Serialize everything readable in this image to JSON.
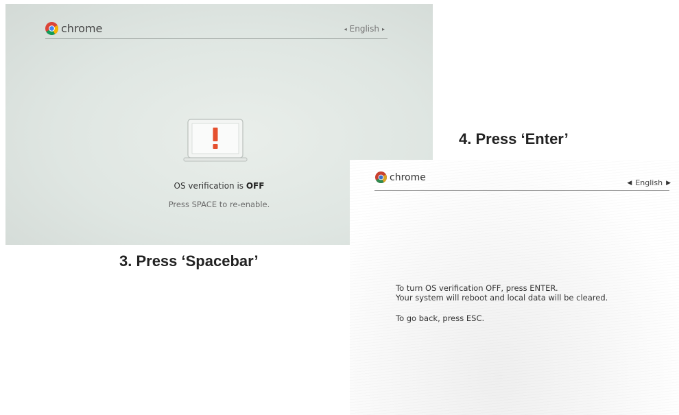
{
  "screen1": {
    "logo_text": "chrome",
    "language": "English",
    "lang_prev_icon": "◂",
    "lang_next_icon": "▸",
    "status_prefix": "OS verification is ",
    "status_value": "OFF",
    "instruction": "Press SPACE to re-enable.",
    "colors": {
      "warning": "#e5502e"
    }
  },
  "caption_step3": "3. Press ‘Spacebar’",
  "caption_step4": "4. Press ‘Enter’",
  "screen2": {
    "logo_text": "chrome",
    "language": "English",
    "lang_prev_icon": "◀",
    "lang_next_icon": "▶",
    "line1": "To turn OS verification OFF, press ENTER.",
    "line2": "Your system will reboot and local data will be cleared.",
    "line3": "To go back, press ESC."
  }
}
